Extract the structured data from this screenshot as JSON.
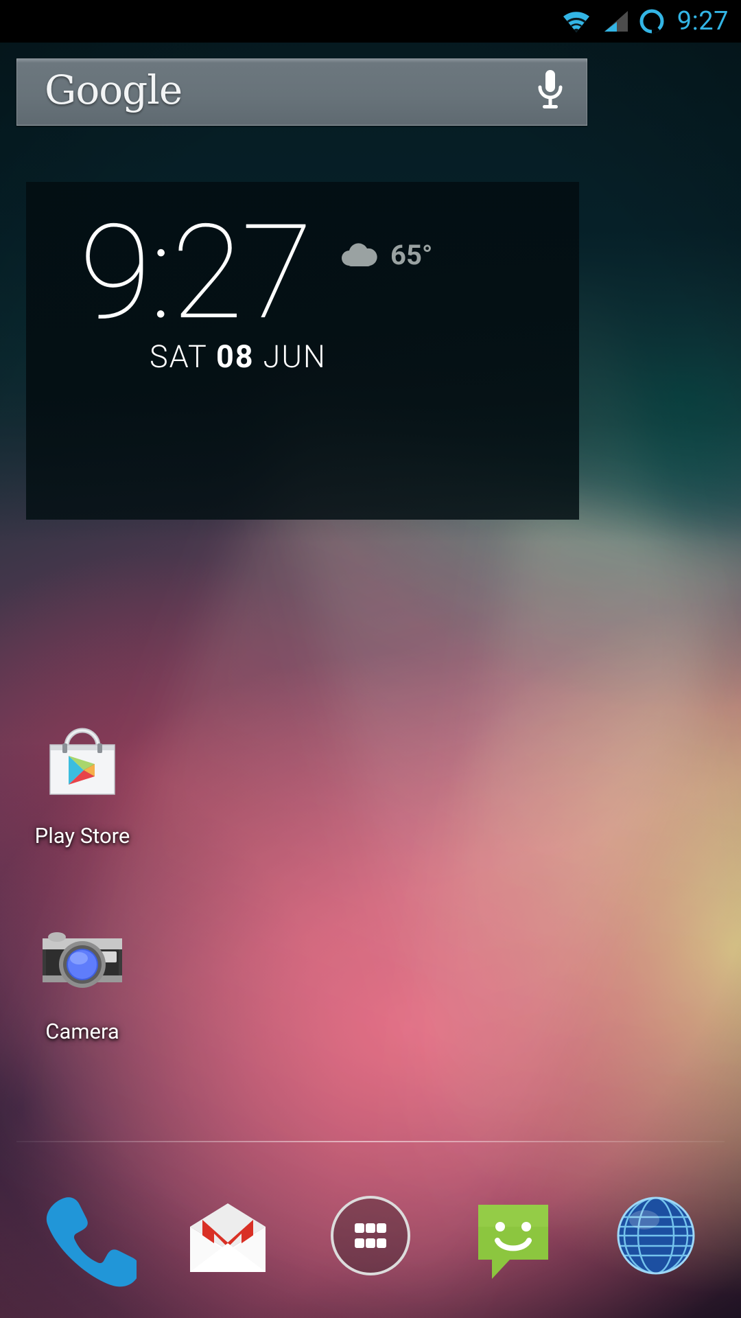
{
  "status_bar": {
    "time": "9:27",
    "icons": [
      "wifi-icon",
      "cellular-signal-icon",
      "sync-circle-icon"
    ],
    "accent_color": "#33b5e5",
    "background": "#000000"
  },
  "search_bar": {
    "logo_text": "Google",
    "mic_icon": "microphone-icon",
    "background_color": "#68737a"
  },
  "clock_widget": {
    "time": "9:27",
    "date_weekday": "SAT",
    "date_day": "08",
    "date_month": "JUN",
    "weather_icon": "cloud-icon",
    "temperature": "65°",
    "temperature_color": "#9aa2a2",
    "background_color": "#030e12"
  },
  "home_apps": [
    {
      "id": "play-store",
      "label": "Play Store",
      "icon": "play-store-icon"
    },
    {
      "id": "camera",
      "label": "Camera",
      "icon": "camera-icon"
    }
  ],
  "dock": [
    {
      "id": "phone",
      "icon": "phone-icon",
      "color": "#1a9ed4"
    },
    {
      "id": "gmail",
      "icon": "gmail-envelope-icon",
      "color": "#d93025"
    },
    {
      "id": "all-apps",
      "icon": "all-apps-grid-icon",
      "color": "#ffffff"
    },
    {
      "id": "messaging",
      "icon": "message-bubble-icon",
      "color": "#8cc63f"
    },
    {
      "id": "browser",
      "icon": "globe-browser-icon",
      "color": "#1b6fc4"
    }
  ],
  "wallpaper": {
    "name": "abstract-light-beams-wallpaper"
  }
}
